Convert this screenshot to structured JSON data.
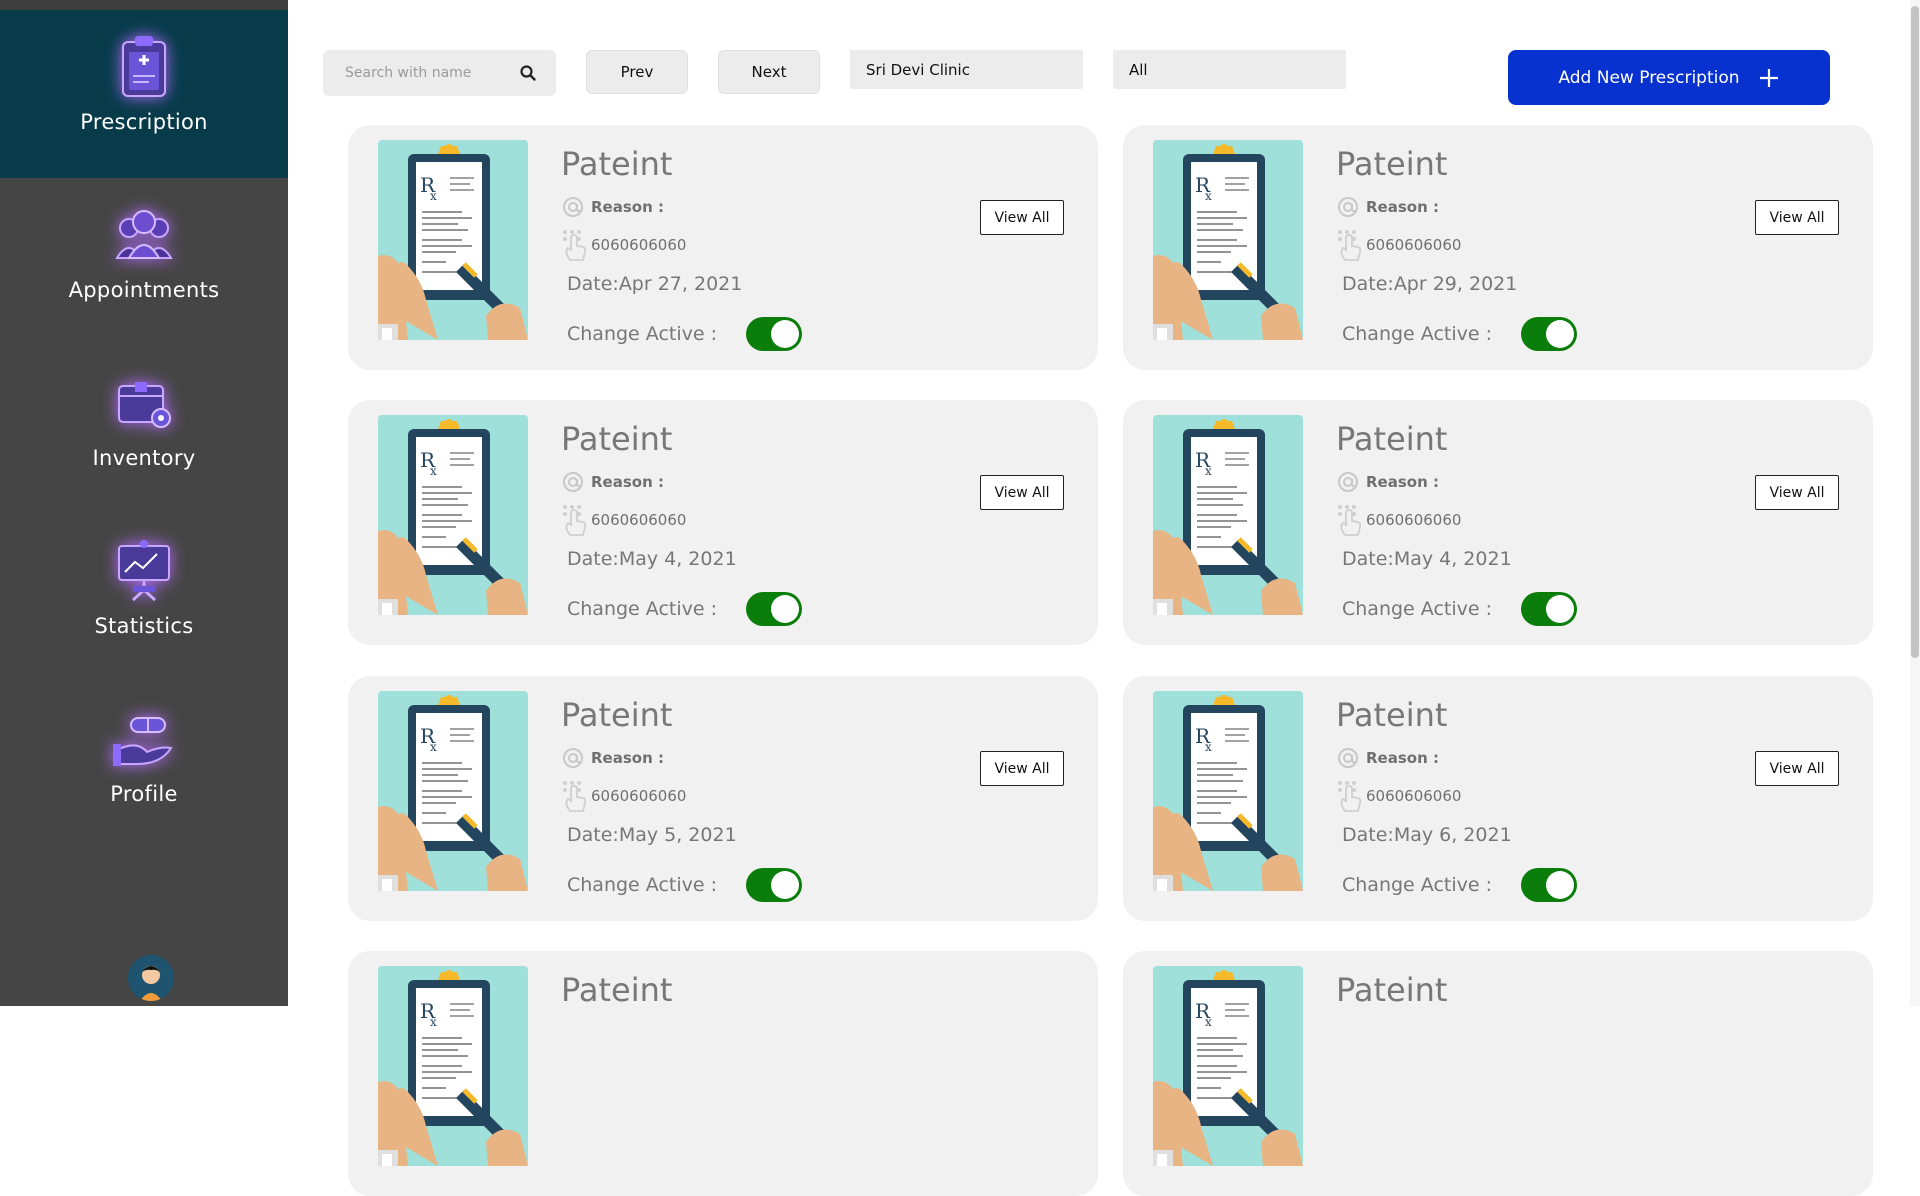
{
  "sidebar": {
    "items": [
      {
        "label": "Prescription",
        "icon": "clipboard-icon",
        "active": true
      },
      {
        "label": "Appointments",
        "icon": "people-icon",
        "active": false
      },
      {
        "label": "Inventory",
        "icon": "box-gear-icon",
        "active": false
      },
      {
        "label": "Statistics",
        "icon": "presentation-board-icon",
        "active": false
      },
      {
        "label": "Profile",
        "icon": "hand-pills-icon",
        "active": false
      }
    ],
    "avatar": "user-avatar"
  },
  "toolbar": {
    "search_placeholder": "Search with name",
    "prev_label": "Prev",
    "next_label": "Next",
    "clinic_selected": "Sri Devi Clinic",
    "status_selected": "All",
    "add_label": "Add New Prescription"
  },
  "cards": [
    {
      "title": "Pateint",
      "reason": "Reason :",
      "phone": "6060606060",
      "date": "Date:Apr 27, 2021",
      "active_label": "Change Active :",
      "active": true,
      "view_label": "View All"
    },
    {
      "title": "Pateint",
      "reason": "Reason :",
      "phone": "6060606060",
      "date": "Date:Apr 29, 2021",
      "active_label": "Change Active :",
      "active": true,
      "view_label": "View All"
    },
    {
      "title": "Pateint",
      "reason": "Reason :",
      "phone": "6060606060",
      "date": "Date:May 4, 2021",
      "active_label": "Change Active :",
      "active": true,
      "view_label": "View All"
    },
    {
      "title": "Pateint",
      "reason": "Reason :",
      "phone": "6060606060",
      "date": "Date:May 4, 2021",
      "active_label": "Change Active :",
      "active": true,
      "view_label": "View All"
    },
    {
      "title": "Pateint",
      "reason": "Reason :",
      "phone": "6060606060",
      "date": "Date:May 5, 2021",
      "active_label": "Change Active :",
      "active": true,
      "view_label": "View All"
    },
    {
      "title": "Pateint",
      "reason": "Reason :",
      "phone": "6060606060",
      "date": "Date:May 6, 2021",
      "active_label": "Change Active :",
      "active": true,
      "view_label": "View All"
    },
    {
      "title": "Pateint"
    },
    {
      "title": "Pateint"
    }
  ],
  "colors": {
    "sidebar_bg": "#454545",
    "sidebar_active": "#073b4a",
    "accent_button": "#0832cf",
    "toggle_on": "#0a7d0a",
    "card_bg": "#f1f1f1"
  }
}
